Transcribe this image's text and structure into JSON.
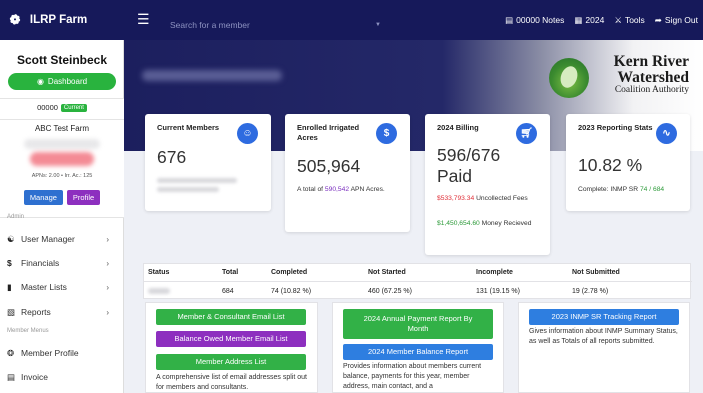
{
  "app": {
    "title": "ILRP Farm",
    "search_placeholder": "Search for a member"
  },
  "topbar": {
    "notes_label": "00000 Notes",
    "year_label": "2024",
    "tools_label": "Tools",
    "signout_label": "Sign Out"
  },
  "sidebar": {
    "user_name": "Scott Steinbeck",
    "dashboard_label": "Dashboard",
    "member_number": "00000",
    "current_badge": "Current",
    "farm_name": "ABC Test Farm",
    "apn_line": "APNs: 2.00 • Irr. Ac.: 125",
    "manage_label": "Manage",
    "profile_label": "Profile",
    "admin_section": "Admin",
    "member_section": "Member Menus",
    "items": [
      {
        "label": "User Manager",
        "icon": "users-icon",
        "chevron": true
      },
      {
        "label": "Financials",
        "icon": "dollar-icon",
        "chevron": true
      },
      {
        "label": "Master Lists",
        "icon": "book-icon",
        "chevron": true
      },
      {
        "label": "Reports",
        "icon": "report-icon",
        "chevron": true
      },
      {
        "label": "Member Profile",
        "icon": "user-circle-icon",
        "chevron": false
      },
      {
        "label": "Invoice",
        "icon": "invoice-icon",
        "chevron": false
      }
    ]
  },
  "banner": {
    "logo_line1": "Kern River",
    "logo_line2": "Watershed",
    "logo_line3": "Coalition Authority"
  },
  "cards": {
    "members": {
      "title": "Current Members",
      "value": "676"
    },
    "enrolled": {
      "title": "Enrolled Irrigated Acres",
      "value": "505,964",
      "note_prefix": "A total of",
      "apn_count": "590,542",
      "note_suffix": "APN Acres."
    },
    "billing": {
      "title": "2024 Billing",
      "value": "596/676 Paid",
      "uncollected_amount": "$533,793.34",
      "uncollected_label": "Uncollected Fees",
      "received_amount": "$1,450,654.60",
      "received_label": "Money Recieved"
    },
    "reporting": {
      "title": "2023 Reporting Stats",
      "value": "10.82 %",
      "complete_prefix": "Complete: INMP SR",
      "complete_done": "74",
      "complete_total": "684"
    }
  },
  "status_table": {
    "headers": [
      "Status",
      "Total",
      "Completed",
      "Not Started",
      "Incomplete",
      "Not Submitted"
    ],
    "row": [
      "",
      "684",
      "74 (10.82 %)",
      "460 (67.25 %)",
      "131 (19.15 %)",
      "19 (2.78 %)"
    ]
  },
  "reports": {
    "col1": {
      "buttons": [
        "Member & Consultant Email List",
        "Balance Owed Member Email List",
        "Member Address List"
      ],
      "text": "A comprehensive list of email addresses split out for members and consultants."
    },
    "col2": {
      "buttons": [
        "2024 Annual Payment Report By Month",
        "2024 Member Balance Report"
      ],
      "text": "Provides information about members current balance, payments for this year, member address, main contact, and a"
    },
    "col3": {
      "buttons": [
        "2023 INMP SR Tracking Report"
      ],
      "text": "Gives information about INMP Summary Status, as well as Totals of all reports submitted."
    }
  },
  "colors": {
    "topbar": "#16195a",
    "accent_blue": "#2e6be0",
    "green": "#32b147",
    "purple": "#8d2fbf",
    "red": "#e0313a"
  }
}
